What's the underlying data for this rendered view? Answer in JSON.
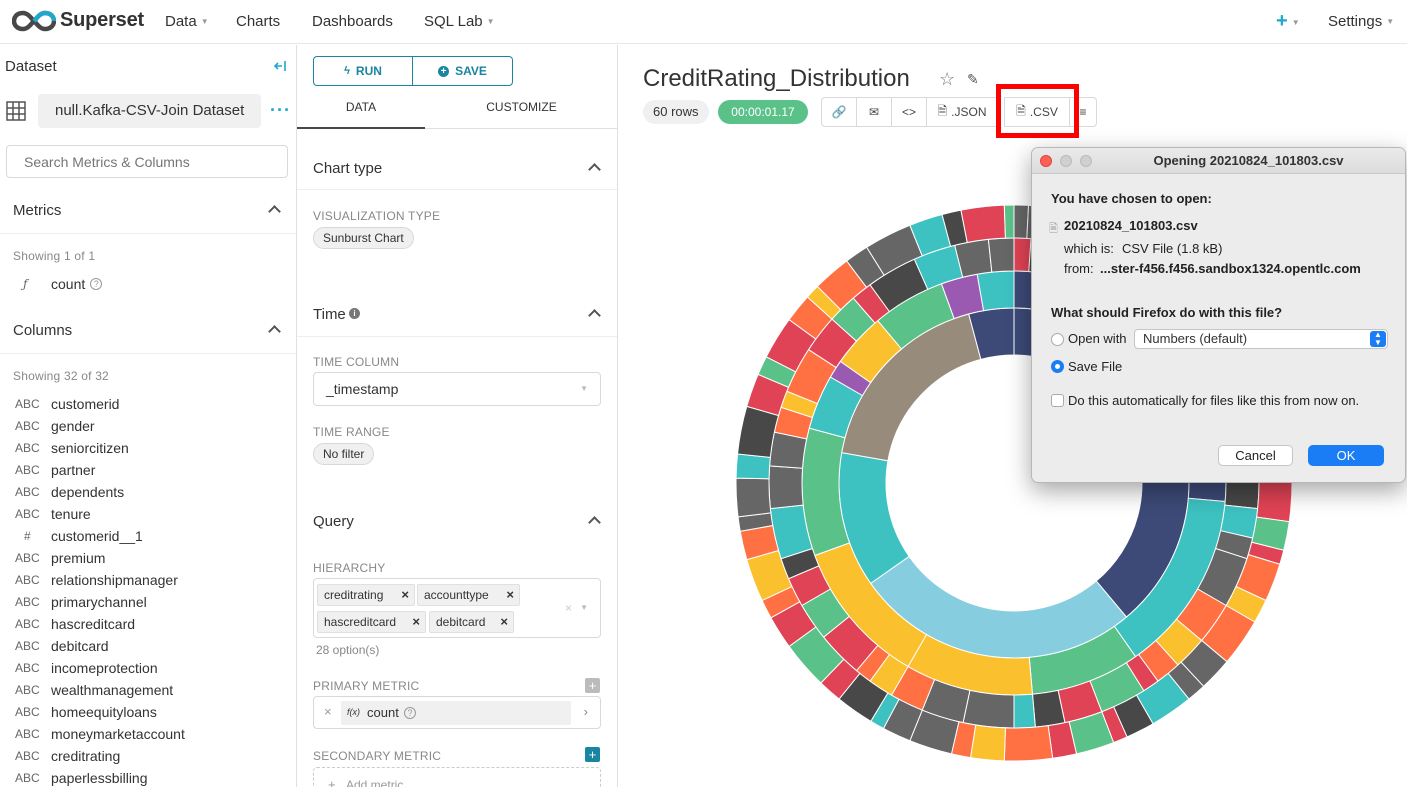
{
  "nav": {
    "brand": "Superset",
    "items": [
      "Data",
      "Charts",
      "Dashboards",
      "SQL Lab"
    ],
    "plus": "+",
    "settings": "Settings"
  },
  "dataset_panel": {
    "title": "Dataset",
    "dataset_name": "null.Kafka-CSV-Join Dataset",
    "search_placeholder": "Search Metrics & Columns",
    "metrics_title": "Metrics",
    "metrics_showing": "Showing 1 of 1",
    "metrics": [
      {
        "type": "ƒ",
        "name": "count"
      }
    ],
    "columns_title": "Columns",
    "columns_showing": "Showing 32 of 32",
    "columns": [
      {
        "type": "ABC",
        "name": "customerid"
      },
      {
        "type": "ABC",
        "name": "gender"
      },
      {
        "type": "ABC",
        "name": "seniorcitizen"
      },
      {
        "type": "ABC",
        "name": "partner"
      },
      {
        "type": "ABC",
        "name": "dependents"
      },
      {
        "type": "ABC",
        "name": "tenure"
      },
      {
        "type": "#",
        "name": "customerid__1"
      },
      {
        "type": "ABC",
        "name": "premium"
      },
      {
        "type": "ABC",
        "name": "relationshipmanager"
      },
      {
        "type": "ABC",
        "name": "primarychannel"
      },
      {
        "type": "ABC",
        "name": "hascreditcard"
      },
      {
        "type": "ABC",
        "name": "debitcard"
      },
      {
        "type": "ABC",
        "name": "incomeprotection"
      },
      {
        "type": "ABC",
        "name": "wealthmanagement"
      },
      {
        "type": "ABC",
        "name": "homeequityloans"
      },
      {
        "type": "ABC",
        "name": "moneymarketaccount"
      },
      {
        "type": "ABC",
        "name": "creditrating"
      },
      {
        "type": "ABC",
        "name": "paperlessbilling"
      }
    ]
  },
  "control_panel": {
    "run_label": "RUN",
    "save_label": "SAVE",
    "tabs": [
      "DATA",
      "CUSTOMIZE"
    ],
    "chart_type_title": "Chart type",
    "viz_type_label": "VISUALIZATION TYPE",
    "viz_type_value": "Sunburst Chart",
    "time_title": "Time",
    "time_column_label": "TIME COLUMN",
    "time_column_value": "_timestamp",
    "time_range_label": "TIME RANGE",
    "time_range_value": "No filter",
    "query_title": "Query",
    "hierarchy_label": "HIERARCHY",
    "hierarchy_values": [
      "creditrating",
      "accounttype",
      "hascreditcard",
      "debitcard"
    ],
    "hierarchy_options": "28 option(s)",
    "primary_metric_label": "PRIMARY METRIC",
    "primary_metric_value": "count",
    "primary_metric_fx": "f(x)",
    "secondary_metric_label": "SECONDARY METRIC",
    "add_metric": "Add metric"
  },
  "chart_header": {
    "title": "CreditRating_Distribution",
    "rows_badge": "60 rows",
    "timer_badge": "00:00:01.17",
    "json_label": ".JSON",
    "csv_label": ".CSV"
  },
  "dialog": {
    "title": "Opening 20210824_101803.csv",
    "chosen_text": "You have chosen to open:",
    "file_name": "20210824_101803.csv",
    "which_is_label": "which is:",
    "which_is_value": "CSV File (1.8 kB)",
    "from_label": "from:",
    "from_value": "...ster-f456.f456.sandbox1324.opentlc.com",
    "question": "What should Firefox do with this file?",
    "open_with_label": "Open with",
    "open_with_app": "Numbers (default)",
    "save_file_label": "Save File",
    "auto_label": "Do this automatically for files like this from now on.",
    "cancel_label": "Cancel",
    "ok_label": "OK",
    "selected_option": "Save File"
  },
  "colors": {
    "accent": "#20a7c9",
    "highlight_box": "#ff0000",
    "timer_green": "#5ac189",
    "mac_blue": "#1a7df5"
  }
}
